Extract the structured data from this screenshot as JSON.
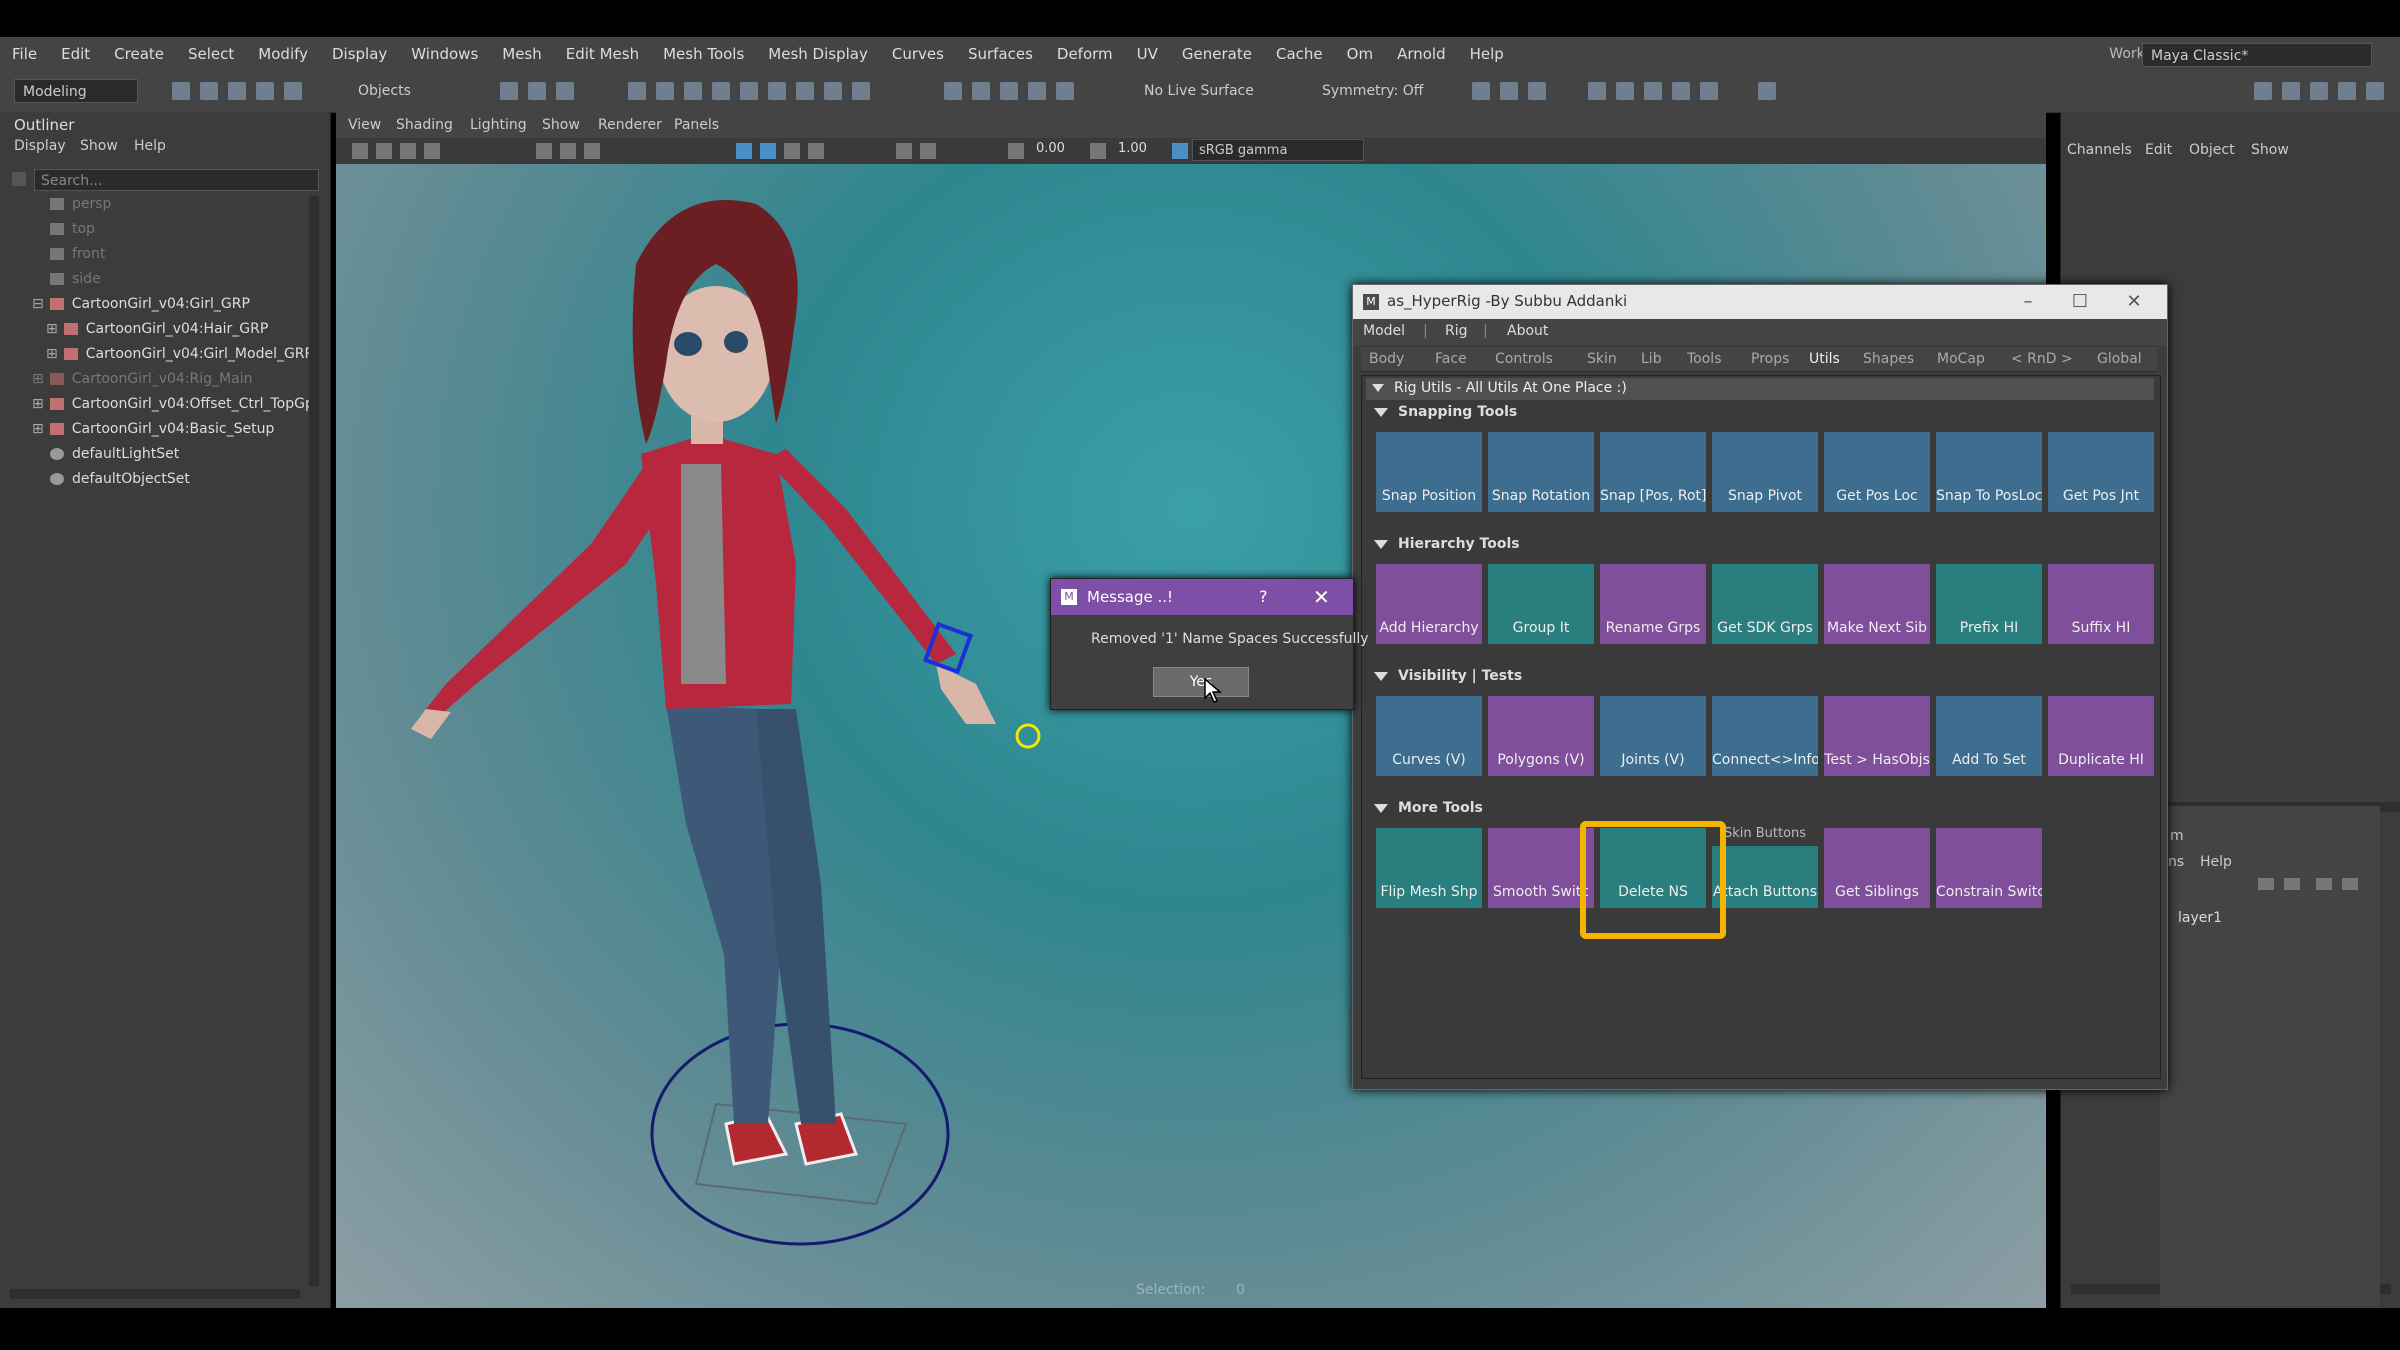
{
  "menubar": {
    "items": [
      "File",
      "Edit",
      "Create",
      "Select",
      "Modify",
      "Display",
      "Windows",
      "Mesh",
      "Edit Mesh",
      "Mesh Tools",
      "Mesh Display",
      "Curves",
      "Surfaces",
      "Deform",
      "UV",
      "Generate",
      "Cache",
      "Om",
      "Arnold",
      "Help"
    ],
    "workspace_label": "Workspace :",
    "workspace_value": "Maya Classic*"
  },
  "shelf": {
    "mode": "Modeling",
    "objects_label": "Objects",
    "live_surface": "No Live Surface",
    "symmetry": "Symmetry: Off"
  },
  "outliner": {
    "title": "Outliner",
    "menu": [
      "Display",
      "Show",
      "Help"
    ],
    "search_placeholder": "Search...",
    "items": [
      {
        "label": "persp",
        "dim": true
      },
      {
        "label": "top",
        "dim": true
      },
      {
        "label": "front",
        "dim": true
      },
      {
        "label": "side",
        "dim": true
      },
      {
        "label": "CartoonGirl_v04:Girl_GRP",
        "dim": false
      },
      {
        "label": "CartoonGirl_v04:Hair_GRP",
        "dim": false
      },
      {
        "label": "CartoonGirl_v04:Girl_Model_GRP",
        "dim": false
      },
      {
        "label": "CartoonGirl_v04:Rig_Main",
        "dim": true
      },
      {
        "label": "CartoonGirl_v04:Offset_Ctrl_TopGp",
        "dim": false
      },
      {
        "label": "CartoonGirl_v04:Basic_Setup",
        "dim": false
      },
      {
        "label": "defaultLightSet",
        "dim": false
      },
      {
        "label": "defaultObjectSet",
        "dim": false
      }
    ]
  },
  "viewport": {
    "menus": [
      "View",
      "Shading",
      "Lighting",
      "Show",
      "Renderer",
      "Panels"
    ],
    "exposure": "0.00",
    "gamma": "1.00",
    "color_space": "sRGB gamma",
    "selection_label": "Selection:",
    "selection_value": "0"
  },
  "channel_box": {
    "menu": [
      "Channels",
      "Edit",
      "Object",
      "Show"
    ],
    "layer_menu_partial": "m",
    "layer_menu": [
      "ns",
      "Help"
    ],
    "layer": "layer1"
  },
  "hyperrig": {
    "title": "as_HyperRig -By Subbu Addanki",
    "menu": [
      "Model",
      "|",
      "Rig",
      "|",
      "About"
    ],
    "tabs": [
      "Body",
      "Face",
      "Controls",
      "Skin",
      "Lib",
      "Tools",
      "Props",
      "Utils",
      "Shapes",
      "MoCap",
      "< RnD >",
      "Global"
    ],
    "active_tab": "Utils",
    "frame_title": "Rig Utils - All Utils At One Place :)",
    "sections": [
      {
        "title": "Snapping Tools",
        "buttons": [
          {
            "label": "Snap Position",
            "icon": "snap-position-icon"
          },
          {
            "label": "Snap Rotation",
            "icon": "snap-rotation-icon"
          },
          {
            "label": "Snap [Pos, Rot]",
            "icon": "snap-pos-rot-icon"
          },
          {
            "label": "Snap Pivot",
            "icon": "snap-pivot-icon"
          },
          {
            "label": "Get Pos Loc",
            "icon": "get-pos-loc-icon"
          },
          {
            "label": "Snap To PosLoc",
            "icon": "snap-to-posloc-icon"
          },
          {
            "label": "Get Pos Jnt",
            "icon": "get-pos-jnt-icon"
          }
        ]
      },
      {
        "title": "Hierarchy Tools",
        "buttons": [
          {
            "label": "Add Hierarchy",
            "icon": "add-hierarchy-icon"
          },
          {
            "label": "Group It",
            "icon": "group-it-icon"
          },
          {
            "label": "Rename Grps",
            "icon": "rename-grps-icon"
          },
          {
            "label": "Get SDK Grps",
            "icon": "get-sdk-grps-icon"
          },
          {
            "label": "Make Next Sib",
            "icon": "make-next-sib-icon"
          },
          {
            "label": "Prefix HI",
            "icon": "prefix-hi-icon"
          },
          {
            "label": "Suffix HI",
            "icon": "suffix-hi-icon"
          }
        ]
      },
      {
        "title": "Visibility | Tests",
        "buttons": [
          {
            "label": "Curves (V)",
            "icon": "curves-icon"
          },
          {
            "label": "Polygons (V)",
            "icon": "polygons-icon"
          },
          {
            "label": "Joints (V)",
            "icon": "joints-icon"
          },
          {
            "label": "Connect<>Info",
            "icon": "connect-info-icon"
          },
          {
            "label": "Test > HasObjs",
            "icon": "test-hasobjs-icon"
          },
          {
            "label": "Add To Set",
            "icon": "add-to-set-icon"
          },
          {
            "label": "Duplicate HI",
            "icon": "duplicate-hi-icon"
          }
        ]
      },
      {
        "title": "More Tools",
        "buttons": [
          {
            "label": "Flip Mesh Shp",
            "icon": "flip-mesh-icon"
          },
          {
            "label": "Smooth Switc",
            "icon": "smooth-switch-icon"
          },
          {
            "label": "Delete NS",
            "icon": "delete-ns-icon"
          },
          {
            "label": "Attach Buttons",
            "icon": "attach-buttons-icon"
          },
          {
            "label": "Get Siblings",
            "icon": "get-siblings-icon"
          },
          {
            "label": "Constrain Switcl",
            "icon": "constrain-switch-icon"
          }
        ]
      }
    ],
    "skin_buttons_label": "Skin Buttons"
  },
  "message": {
    "title": "Message ..!",
    "help": "?",
    "close": "✕",
    "text": "Removed '1' Name Spaces Successfully",
    "button": "Yes"
  },
  "colors": {
    "accent": "#7e4fa6",
    "highlight": "#f5b400",
    "blue_btn": "#3d6d8f",
    "purple_btn": "#7f4f9c",
    "teal_btn": "#2a7f7e"
  }
}
